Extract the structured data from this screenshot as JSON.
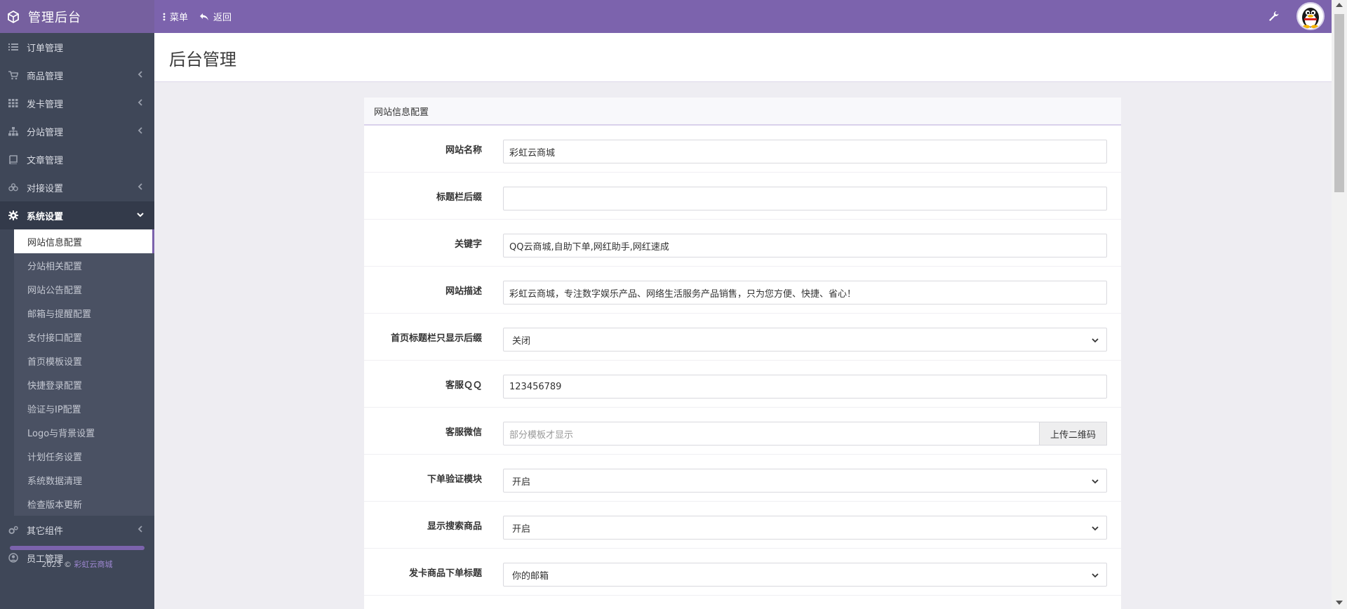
{
  "app": {
    "title": "管理后台"
  },
  "topnav": {
    "menu_label": "菜单",
    "back_label": "返回"
  },
  "sidebar": {
    "items": [
      {
        "label": "订单管理",
        "icon": "list-icon"
      },
      {
        "label": "商品管理",
        "icon": "cart-icon"
      },
      {
        "label": "发卡管理",
        "icon": "grid-icon"
      },
      {
        "label": "分站管理",
        "icon": "sitemap-icon"
      },
      {
        "label": "文章管理",
        "icon": "book-icon"
      },
      {
        "label": "对接设置",
        "icon": "link-icon"
      },
      {
        "label": "系统设置",
        "icon": "gear-icon"
      },
      {
        "label": "其它组件",
        "icon": "cogs-icon"
      },
      {
        "label": "员工管理",
        "icon": "user-circle-icon"
      }
    ],
    "submenu": [
      "网站信息配置",
      "分站相关配置",
      "网站公告配置",
      "邮箱与提醒配置",
      "支付接口配置",
      "首页模板设置",
      "快捷登录配置",
      "验证与IP配置",
      "Logo与背景设置",
      "计划任务设置",
      "系统数据清理",
      "检查版本更新"
    ],
    "copyright_prefix": "2023 ©",
    "copyright_link": "彩虹云商城"
  },
  "page": {
    "title": "后台管理"
  },
  "panel": {
    "title": "网站信息配置",
    "fields": {
      "site_name": {
        "label": "网站名称",
        "value": "彩虹云商城"
      },
      "title_suffix": {
        "label": "标题栏后缀",
        "value": ""
      },
      "keywords": {
        "label": "关键字",
        "value": "QQ云商城,自助下单,网红助手,网红速成"
      },
      "description": {
        "label": "网站描述",
        "value": "彩虹云商城，专注数字娱乐产品、网络生活服务产品销售，只为您方便、快捷、省心！"
      },
      "title_only_suffix": {
        "label": "首页标题栏只显示后缀",
        "value": "关闭"
      },
      "service_qq": {
        "label": "客服ＱＱ",
        "value": "123456789"
      },
      "service_wechat": {
        "label": "客服微信",
        "placeholder": "部分模板才显示",
        "button": "上传二维码"
      },
      "order_verify": {
        "label": "下单验证模块",
        "value": "开启"
      },
      "show_search": {
        "label": "显示搜索商品",
        "value": "开启"
      },
      "card_order_title": {
        "label": "发卡商品下单标题",
        "value": "你的邮箱"
      }
    }
  },
  "colors": {
    "accent": "#7c63ad",
    "sidebar_bg": "#3f4758",
    "body_bg": "#eeedf2"
  }
}
